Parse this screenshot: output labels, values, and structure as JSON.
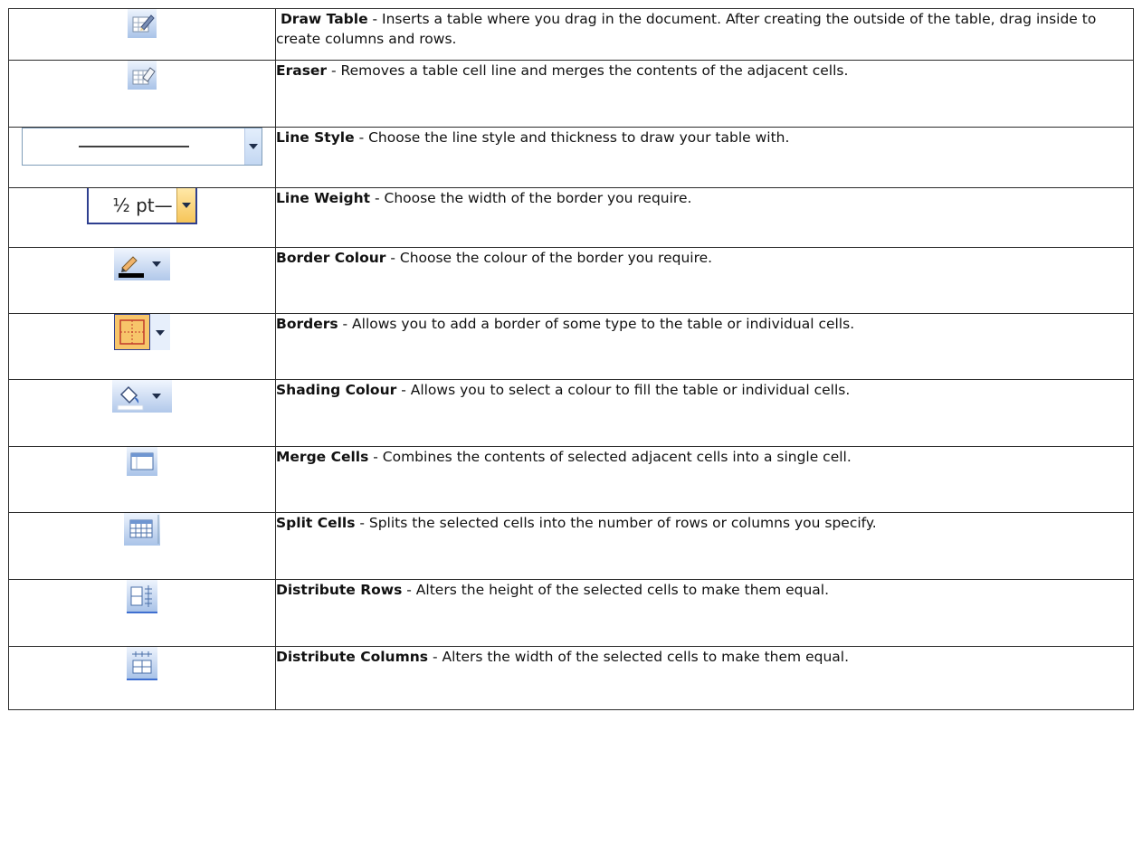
{
  "rows": [
    {
      "icon": "draw-table-icon",
      "name": "Draw Table",
      "desc": " - Inserts a table where you drag in the document. After creating the outside of the table, drag inside to create columns and rows."
    },
    {
      "icon": "eraser-icon",
      "name": "Eraser",
      "desc": " - Removes a table cell line and merges the contents of the adjacent cells."
    },
    {
      "icon": "line-style-dropdown",
      "name": "Line Style",
      "desc": " - Choose the line style and thickness to draw your table with."
    },
    {
      "icon": "line-weight-dropdown",
      "name": "Line Weight",
      "desc": " - Choose the width of the border you require.",
      "widget_label": "½ pt—"
    },
    {
      "icon": "border-colour-icon",
      "name": "Border Colour",
      "desc": " - Choose the colour of the border you require."
    },
    {
      "icon": "borders-icon",
      "name": "Borders",
      "desc": " - Allows you to add a border of some type to the table or individual cells."
    },
    {
      "icon": "shading-colour-icon",
      "name": "Shading Colour",
      "desc": " - Allows you to select a colour to fill the table or individual cells."
    },
    {
      "icon": "merge-cells-icon",
      "name": "Merge Cells",
      "desc": " - Combines the contents of selected adjacent cells into a single cell."
    },
    {
      "icon": "split-cells-icon",
      "name": "Split Cells",
      "desc": " - Splits the selected cells into the number of rows or columns you specify."
    },
    {
      "icon": "distribute-rows-icon",
      "name": "Distribute Rows",
      "desc": " - Alters the height of the selected cells to make them equal."
    },
    {
      "icon": "distribute-columns-icon",
      "name": "Distribute Columns",
      "desc": " - Alters the width of the selected cells to make them equal."
    }
  ],
  "colors": {
    "icon_blue_light": "#e6eefb",
    "icon_blue_dark": "#9fb9e2",
    "highlight_orange": "#f7c56a",
    "border": "#2b2b2b"
  }
}
